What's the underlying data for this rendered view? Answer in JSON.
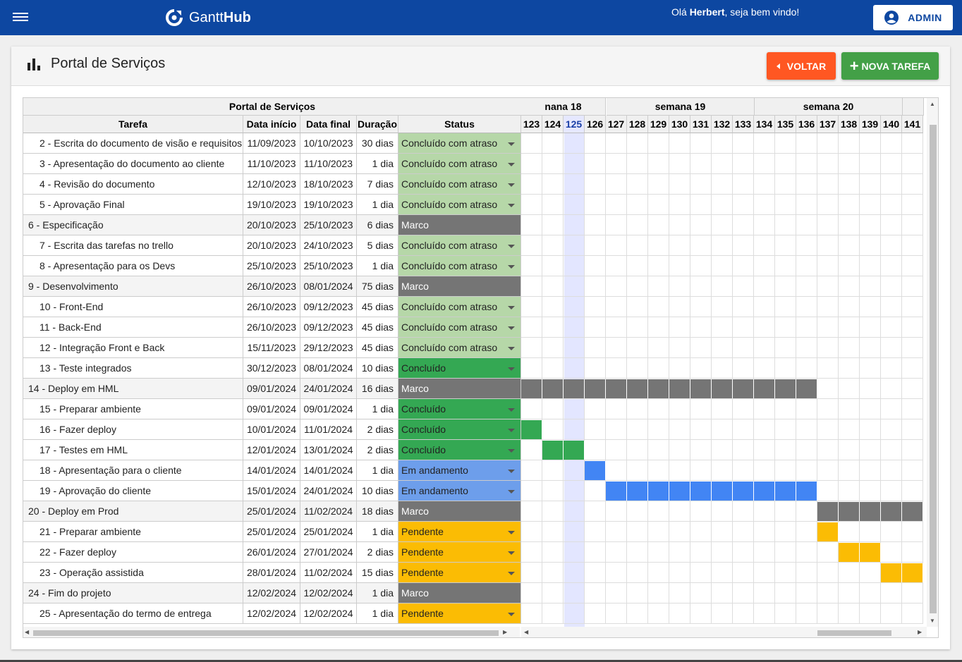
{
  "app": {
    "name_light": "Gantt",
    "name_bold": "Hub"
  },
  "header": {
    "greeting_prefix": "Olá ",
    "user": "Herbert",
    "greeting_suffix": ", seja bem vindo!",
    "admin_label": "ADMIN"
  },
  "page": {
    "title": "Portal de Serviços",
    "back_label": "VOLTAR",
    "new_task_label": "NOVA TAREFA"
  },
  "gantt": {
    "title": "Portal de Serviços",
    "columns": [
      "Tarefa",
      "Data início",
      "Data final",
      "Duração",
      "Status"
    ],
    "weeks": [
      {
        "label": "nana 18"
      },
      {
        "label": "semana 19"
      },
      {
        "label": "semana 20"
      }
    ],
    "days": [
      "123",
      "124",
      "125",
      "126",
      "127",
      "128",
      "129",
      "130",
      "131",
      "132",
      "133",
      "134",
      "135",
      "136",
      "137",
      "138",
      "139",
      "140",
      "141"
    ],
    "today": "125",
    "status_colors": {
      "Concluído com atraso": "#b6d7a8",
      "Concluído": "#34a853",
      "Marco": "#757575",
      "Em andamento": "#6d9eeb",
      "Pendente": "#fbbc04"
    },
    "bar_colors": {
      "Marco": "#757575",
      "Concluído": "#34a853",
      "Em andamento": "#4285f4",
      "Pendente": "#fbbc04"
    },
    "rows": [
      {
        "task": "2 - Escrita do documento de visão e requisitos",
        "start": "11/09/2023",
        "end": "10/10/2023",
        "duration": "30 dias",
        "status": "Concluído com atraso",
        "group": false
      },
      {
        "task": "3 - Apresentação do documento ao cliente",
        "start": "11/10/2023",
        "end": "11/10/2023",
        "duration": "1 dia",
        "status": "Concluído com atraso",
        "group": false
      },
      {
        "task": "4 - Revisão do documento",
        "start": "12/10/2023",
        "end": "18/10/2023",
        "duration": "7 dias",
        "status": "Concluído com atraso",
        "group": false
      },
      {
        "task": "5 - Aprovação Final",
        "start": "19/10/2023",
        "end": "19/10/2023",
        "duration": "1 dia",
        "status": "Concluído com atraso",
        "group": false
      },
      {
        "task": "6 - Especificação",
        "start": "20/10/2023",
        "end": "25/10/2023",
        "duration": "6 dias",
        "status": "Marco",
        "group": true
      },
      {
        "task": "7 - Escrita das tarefas no trello",
        "start": "20/10/2023",
        "end": "24/10/2023",
        "duration": "5 dias",
        "status": "Concluído com atraso",
        "group": false
      },
      {
        "task": "8 - Apresentação para os Devs",
        "start": "25/10/2023",
        "end": "25/10/2023",
        "duration": "1 dia",
        "status": "Concluído com atraso",
        "group": false
      },
      {
        "task": "9 - Desenvolvimento",
        "start": "26/10/2023",
        "end": "08/01/2024",
        "duration": "75 dias",
        "status": "Marco",
        "group": true
      },
      {
        "task": "10 - Front-End",
        "start": "26/10/2023",
        "end": "09/12/2023",
        "duration": "45 dias",
        "status": "Concluído com atraso",
        "group": false
      },
      {
        "task": "11 - Back-End",
        "start": "26/10/2023",
        "end": "09/12/2023",
        "duration": "45 dias",
        "status": "Concluído com atraso",
        "group": false
      },
      {
        "task": "12 - Integração Front e Back",
        "start": "15/11/2023",
        "end": "29/12/2023",
        "duration": "45 dias",
        "status": "Concluído com atraso",
        "group": false
      },
      {
        "task": "13 - Teste integrados",
        "start": "30/12/2023",
        "end": "08/01/2024",
        "duration": "10 dias",
        "status": "Concluído",
        "group": false
      },
      {
        "task": "14 - Deploy em HML",
        "start": "09/01/2024",
        "end": "24/01/2024",
        "duration": "16 dias",
        "status": "Marco",
        "group": true,
        "bar": [
          "123",
          "136"
        ]
      },
      {
        "task": "15 - Preparar ambiente",
        "start": "09/01/2024",
        "end": "09/01/2024",
        "duration": "1 dia",
        "status": "Concluído",
        "group": false
      },
      {
        "task": "16 - Fazer deploy",
        "start": "10/01/2024",
        "end": "11/01/2024",
        "duration": "2 dias",
        "status": "Concluído",
        "group": false,
        "bar": [
          "123",
          "123"
        ]
      },
      {
        "task": "17 - Testes em HML",
        "start": "12/01/2024",
        "end": "13/01/2024",
        "duration": "2 dias",
        "status": "Concluído",
        "group": false,
        "bar": [
          "124",
          "125"
        ]
      },
      {
        "task": "18 - Apresentação para o cliente",
        "start": "14/01/2024",
        "end": "14/01/2024",
        "duration": "1 dia",
        "status": "Em andamento",
        "group": false,
        "bar": [
          "126",
          "126"
        ]
      },
      {
        "task": "19 - Aprovação do cliente",
        "start": "15/01/2024",
        "end": "24/01/2024",
        "duration": "10 dias",
        "status": "Em andamento",
        "group": false,
        "bar": [
          "127",
          "136"
        ]
      },
      {
        "task": "20 - Deploy em Prod",
        "start": "25/01/2024",
        "end": "11/02/2024",
        "duration": "18 dias",
        "status": "Marco",
        "group": true,
        "bar": [
          "137",
          "141"
        ]
      },
      {
        "task": "21 - Preparar ambiente",
        "start": "25/01/2024",
        "end": "25/01/2024",
        "duration": "1 dia",
        "status": "Pendente",
        "group": false,
        "bar": [
          "137",
          "137"
        ]
      },
      {
        "task": "22 - Fazer deploy",
        "start": "26/01/2024",
        "end": "27/01/2024",
        "duration": "2 dias",
        "status": "Pendente",
        "group": false,
        "bar": [
          "138",
          "139"
        ]
      },
      {
        "task": "23 - Operação assistida",
        "start": "28/01/2024",
        "end": "11/02/2024",
        "duration": "15 dias",
        "status": "Pendente",
        "group": false,
        "bar": [
          "140",
          "141"
        ]
      },
      {
        "task": "24 - Fim do projeto",
        "start": "12/02/2024",
        "end": "12/02/2024",
        "duration": "1 dia",
        "status": "Marco",
        "group": true
      },
      {
        "task": "25 - Apresentação do termo de entrega",
        "start": "12/02/2024",
        "end": "12/02/2024",
        "duration": "1 dia",
        "status": "Pendente",
        "group": false
      }
    ]
  }
}
